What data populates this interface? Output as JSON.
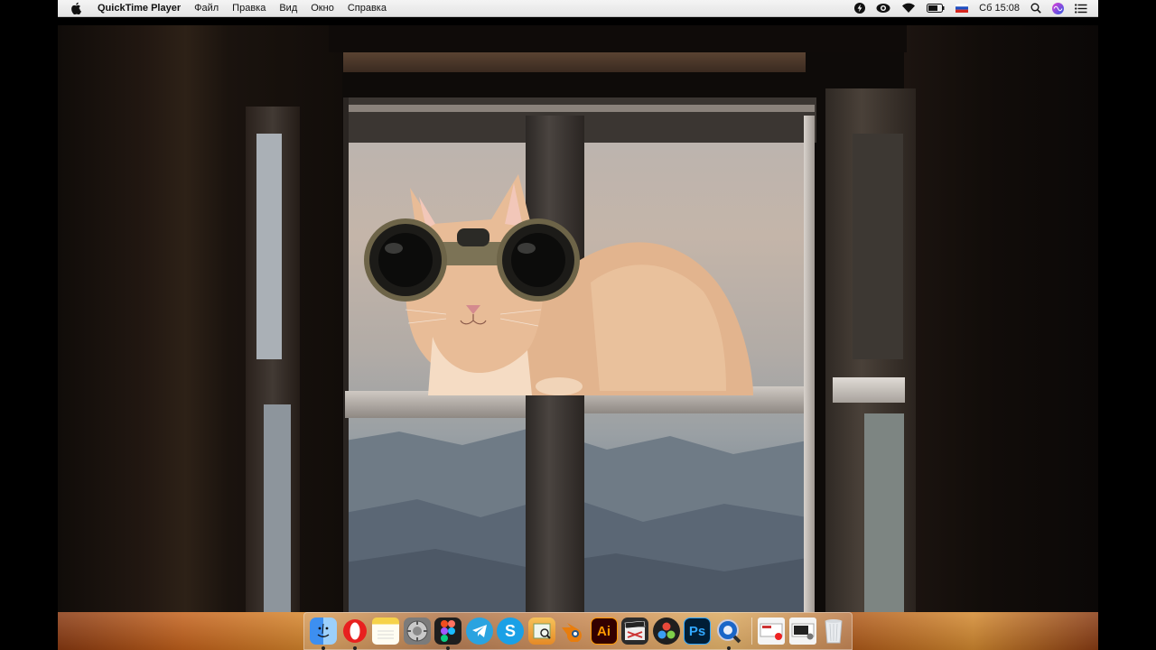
{
  "menubar": {
    "apple_icon": "apple-icon",
    "app_name": "QuickTime Player",
    "items": [
      "Файл",
      "Правка",
      "Вид",
      "Окно",
      "Справка"
    ],
    "status": {
      "icons": [
        "lightning-icon",
        "eye-icon",
        "wifi-icon",
        "battery-icon",
        "russian-flag-icon"
      ],
      "clock": "Сб 15:08",
      "right_icons": [
        "search-icon",
        "siri-icon",
        "notification-center-icon"
      ]
    }
  },
  "video": {
    "description_icons": [
      "cat-with-binoculars"
    ]
  },
  "dock": {
    "apps": [
      {
        "name": "Finder",
        "icon": "finder-icon",
        "running": true,
        "color": "#3d8ff0"
      },
      {
        "name": "Opera",
        "icon": "opera-icon",
        "running": true,
        "color": "#e8201f"
      },
      {
        "name": "Notes",
        "icon": "notes-icon",
        "running": false,
        "color": "#f6d24a"
      },
      {
        "name": "System Preferences",
        "icon": "gear-icon",
        "running": false,
        "color": "#7b7b7b"
      },
      {
        "name": "Figma",
        "icon": "figma-icon",
        "running": true,
        "color": "#1e1e1e"
      },
      {
        "name": "Telegram",
        "icon": "telegram-icon",
        "running": false,
        "color": "#2aa3e0"
      },
      {
        "name": "Skype",
        "icon": "skype-icon",
        "running": false,
        "color": "#1aa0e6"
      },
      {
        "name": "Preview",
        "icon": "preview-icon",
        "running": false,
        "color": "#f1a23b"
      },
      {
        "name": "Blender",
        "icon": "blender-icon",
        "running": false,
        "color": "#e87d0d"
      },
      {
        "name": "Illustrator",
        "icon": "illustrator-icon",
        "label": "Ai",
        "running": false,
        "color": "#330000"
      },
      {
        "name": "Final Cut Pro",
        "icon": "final-cut-icon",
        "running": false,
        "color": "#2b2b2b"
      },
      {
        "name": "DaVinci Resolve",
        "icon": "davinci-icon",
        "running": false,
        "color": "#1f1f1f"
      },
      {
        "name": "Photoshop",
        "icon": "photoshop-icon",
        "label": "Ps",
        "running": false,
        "color": "#001e36"
      },
      {
        "name": "QuickTime Player",
        "icon": "quicktime-icon",
        "running": true,
        "color": "#1a66c8"
      }
    ],
    "right_items": [
      {
        "name": "Downloads",
        "icon": "downloads-stack-icon"
      },
      {
        "name": "Documents",
        "icon": "documents-stack-icon"
      },
      {
        "name": "Trash",
        "icon": "trash-icon"
      }
    ]
  }
}
